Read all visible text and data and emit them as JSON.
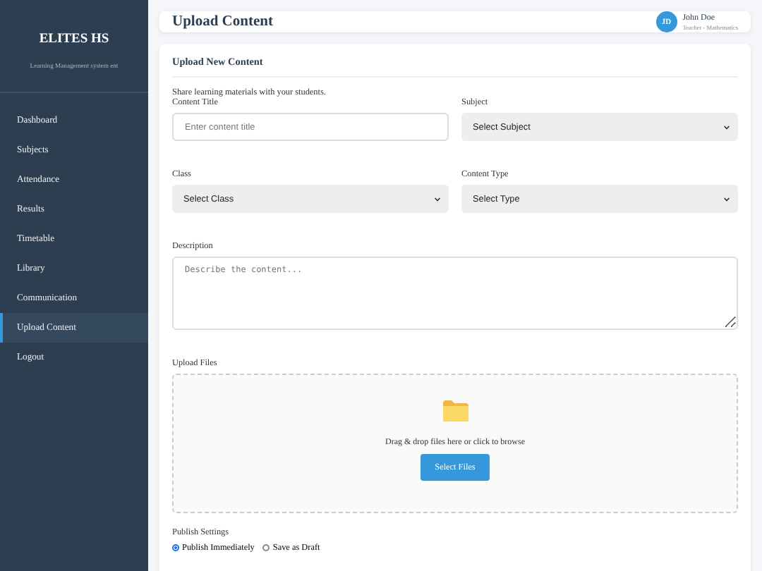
{
  "sidebar": {
    "brand": "ELITES HS",
    "subtitle": "Learning Management system ent",
    "items": [
      {
        "label": "Dashboard",
        "selected": false
      },
      {
        "label": "Subjects",
        "selected": false
      },
      {
        "label": "Attendance",
        "selected": false
      },
      {
        "label": "Results",
        "selected": false
      },
      {
        "label": "Timetable",
        "selected": false
      },
      {
        "label": "Library",
        "selected": false
      },
      {
        "label": "Communication",
        "selected": false
      },
      {
        "label": "Upload Content",
        "selected": true
      },
      {
        "label": "Logout",
        "selected": false
      }
    ]
  },
  "header": {
    "title": "Upload Content",
    "user": {
      "initials": "JD",
      "name": "John Doe",
      "role": "Teacher - Mathematics"
    }
  },
  "form": {
    "title": "Upload New Content",
    "description": "Share learning materials with your students.",
    "fields": [
      {
        "kind": "input",
        "label": "Content Title",
        "placeholder": "Enter content title"
      },
      {
        "kind": "select",
        "label": "Subject",
        "value": "Select Subject"
      },
      {
        "kind": "select",
        "label": "Class",
        "value": "Select Class"
      },
      {
        "kind": "select",
        "label": "Content Type",
        "value": "Select Type"
      },
      {
        "kind": "textarea",
        "label": "Description",
        "placeholder": "Describe the content..."
      }
    ],
    "upload": {
      "label": "Upload Files",
      "hint": "Drag & drop files here or click to browse",
      "button": "Select Files"
    },
    "publish": {
      "label": "Publish Settings",
      "options": [
        {
          "label": "Publish Immediately",
          "selected": true
        },
        {
          "label": "Save as Draft",
          "selected": false
        }
      ]
    }
  }
}
